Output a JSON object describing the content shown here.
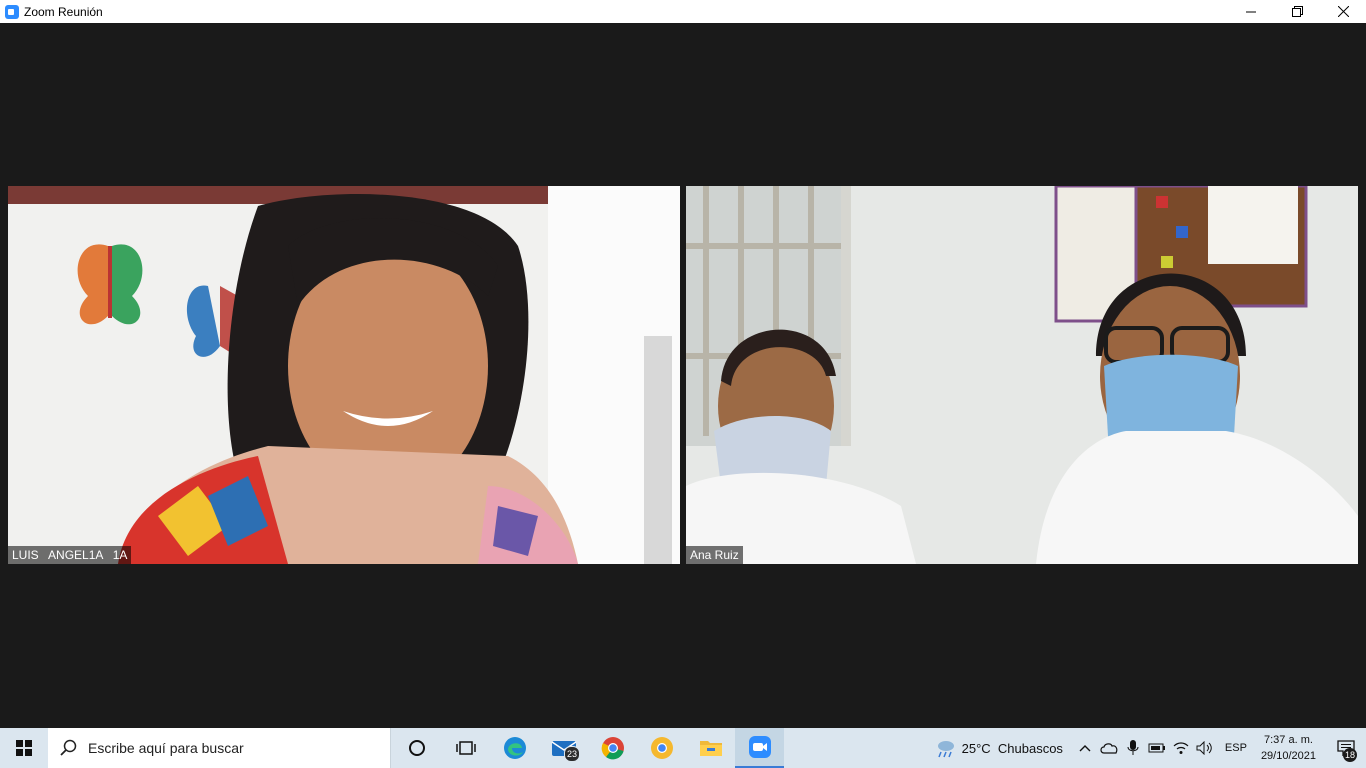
{
  "window": {
    "title": "Zoom Reunión"
  },
  "participants": [
    {
      "name": "LUIS   ANGEL1A   1A"
    },
    {
      "name": "Ana Ruiz"
    }
  ],
  "taskbar": {
    "search_placeholder": "Escribe aquí para buscar",
    "mail_badge": "23",
    "apps": [
      "cortana-icon",
      "task-view-icon",
      "edge-icon",
      "mail-icon",
      "chrome-icon",
      "chrome-canary-icon",
      "file-explorer-icon",
      "zoom-icon"
    ]
  },
  "tray": {
    "weather_text": "25°C  Chubascos",
    "language": "ESP",
    "time": "7:37 a. m.",
    "date": "29/10/2021",
    "notification_count": "18"
  },
  "colors": {
    "meeting_bg": "#1a1a1a",
    "taskbar_bg": "#dbe6ef",
    "zoom_blue": "#2d8cff"
  }
}
